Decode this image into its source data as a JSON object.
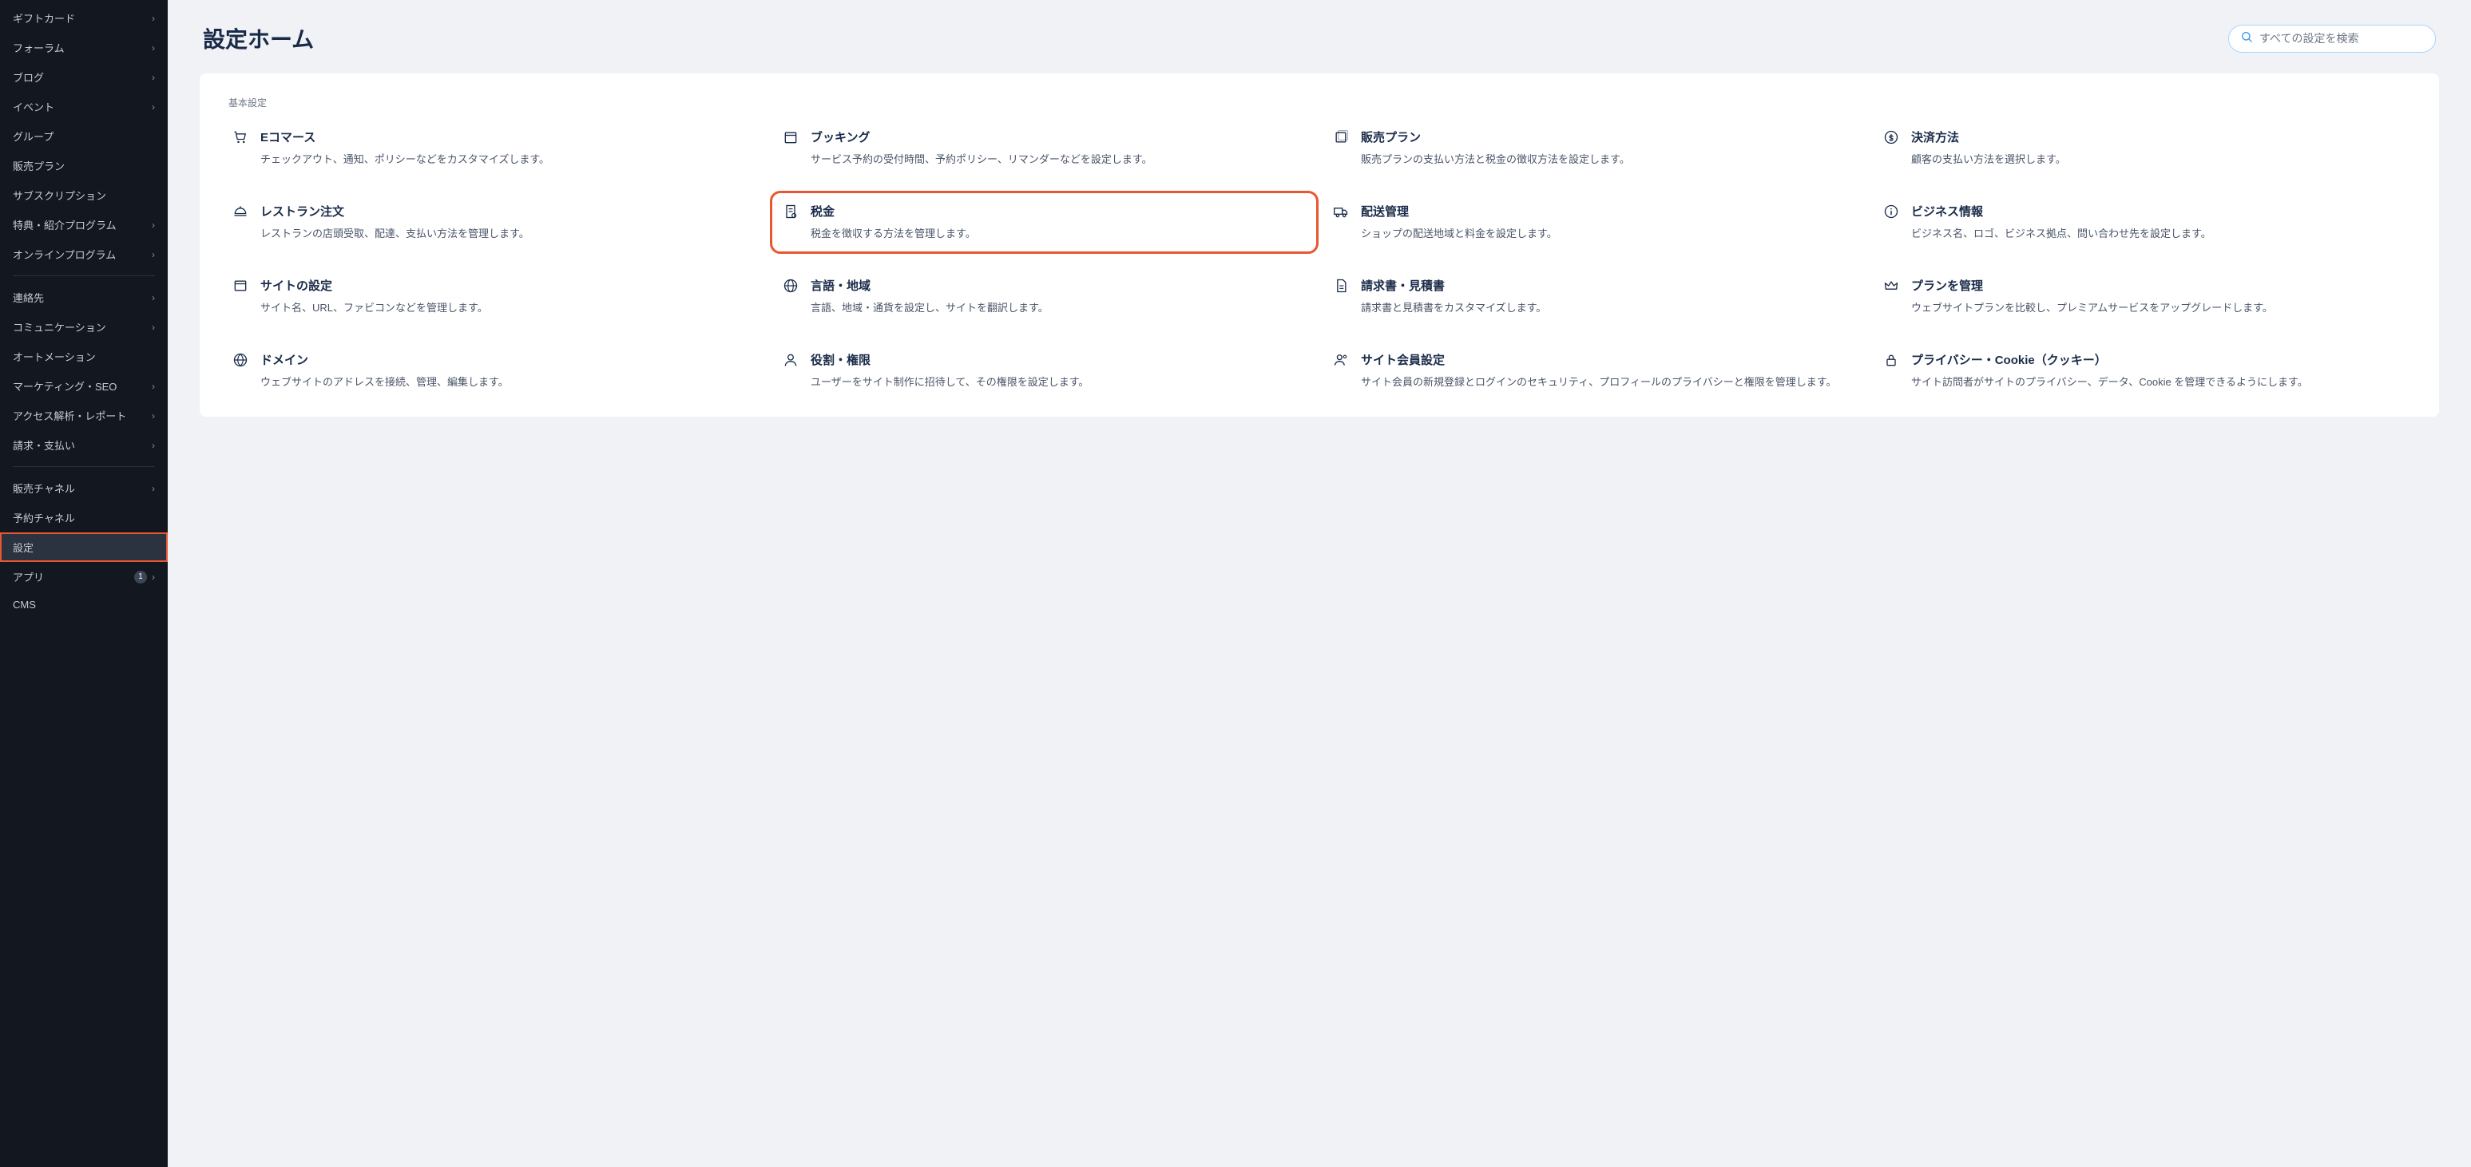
{
  "page": {
    "title": "設定ホーム",
    "search_placeholder": "すべての設定を検索"
  },
  "sidebar": {
    "items": [
      {
        "label": "ギフトカード",
        "chevron": true
      },
      {
        "label": "フォーラム",
        "chevron": true
      },
      {
        "label": "ブログ",
        "chevron": true
      },
      {
        "label": "イベント",
        "chevron": true
      },
      {
        "label": "グループ",
        "chevron": false
      },
      {
        "label": "販売プラン",
        "chevron": false
      },
      {
        "label": "サブスクリプション",
        "chevron": false
      },
      {
        "label": "特典・紹介プログラム",
        "chevron": true
      },
      {
        "label": "オンラインプログラム",
        "chevron": true
      }
    ],
    "items2": [
      {
        "label": "連絡先",
        "chevron": true
      },
      {
        "label": "コミュニケーション",
        "chevron": true
      },
      {
        "label": "オートメーション",
        "chevron": false
      },
      {
        "label": "マーケティング・SEO",
        "chevron": true
      },
      {
        "label": "アクセス解析・レポート",
        "chevron": true
      },
      {
        "label": "請求・支払い",
        "chevron": true
      }
    ],
    "items3": [
      {
        "label": "販売チャネル",
        "chevron": true
      },
      {
        "label": "予約チャネル",
        "chevron": false
      },
      {
        "label": "設定",
        "chevron": false,
        "active": true
      },
      {
        "label": "アプリ",
        "chevron": true,
        "badge": "1"
      },
      {
        "label": "CMS",
        "chevron": false
      }
    ]
  },
  "section": {
    "heading": "基本設定"
  },
  "cards": [
    {
      "icon": "cart",
      "title": "Eコマース",
      "desc": "チェックアウト、通知、ポリシーなどをカスタマイズします。"
    },
    {
      "icon": "calendar",
      "title": "ブッキング",
      "desc": "サービス予約の受付時間、予約ポリシー、リマンダーなどを設定します。"
    },
    {
      "icon": "stack",
      "title": "販売プラン",
      "desc": "販売プランの支払い方法と税金の徴収方法を設定します。"
    },
    {
      "icon": "dollar",
      "title": "決済方法",
      "desc": "顧客の支払い方法を選択します。"
    },
    {
      "icon": "dish",
      "title": "レストラン注文",
      "desc": "レストランの店頭受取、配達、支払い方法を管理します。"
    },
    {
      "icon": "receipt",
      "title": "税金",
      "desc": "税金を徴収する方法を管理します。",
      "highlight": true
    },
    {
      "icon": "truck",
      "title": "配送管理",
      "desc": "ショップの配送地域と料金を設定します。"
    },
    {
      "icon": "info",
      "title": "ビジネス情報",
      "desc": "ビジネス名、ロゴ、ビジネス拠点、問い合わせ先を設定します。"
    },
    {
      "icon": "browser",
      "title": "サイトの設定",
      "desc": "サイト名、URL、ファビコンなどを管理します。"
    },
    {
      "icon": "globe",
      "title": "言語・地域",
      "desc": "言語、地域・通貨を設定し、サイトを翻訳します。"
    },
    {
      "icon": "doc",
      "title": "請求書・見積書",
      "desc": "請求書と見積書をカスタマイズします。"
    },
    {
      "icon": "crown",
      "title": "プランを管理",
      "desc": "ウェブサイトプランを比較し、プレミアムサービスをアップグレードします。"
    },
    {
      "icon": "world",
      "title": "ドメイン",
      "desc": "ウェブサイトのアドレスを接続、管理、編集します。"
    },
    {
      "icon": "person",
      "title": "役割・権限",
      "desc": "ユーザーをサイト制作に招待して、その権限を設定します。"
    },
    {
      "icon": "member",
      "title": "サイト会員設定",
      "desc": "サイト会員の新規登録とログインのセキュリティ、プロフィールのプライバシーと権限を管理します。"
    },
    {
      "icon": "lock",
      "title": "プライバシー・Cookie（クッキー）",
      "desc": "サイト訪問者がサイトのプライバシー、データ、Cookie を管理できるようにします。"
    }
  ]
}
